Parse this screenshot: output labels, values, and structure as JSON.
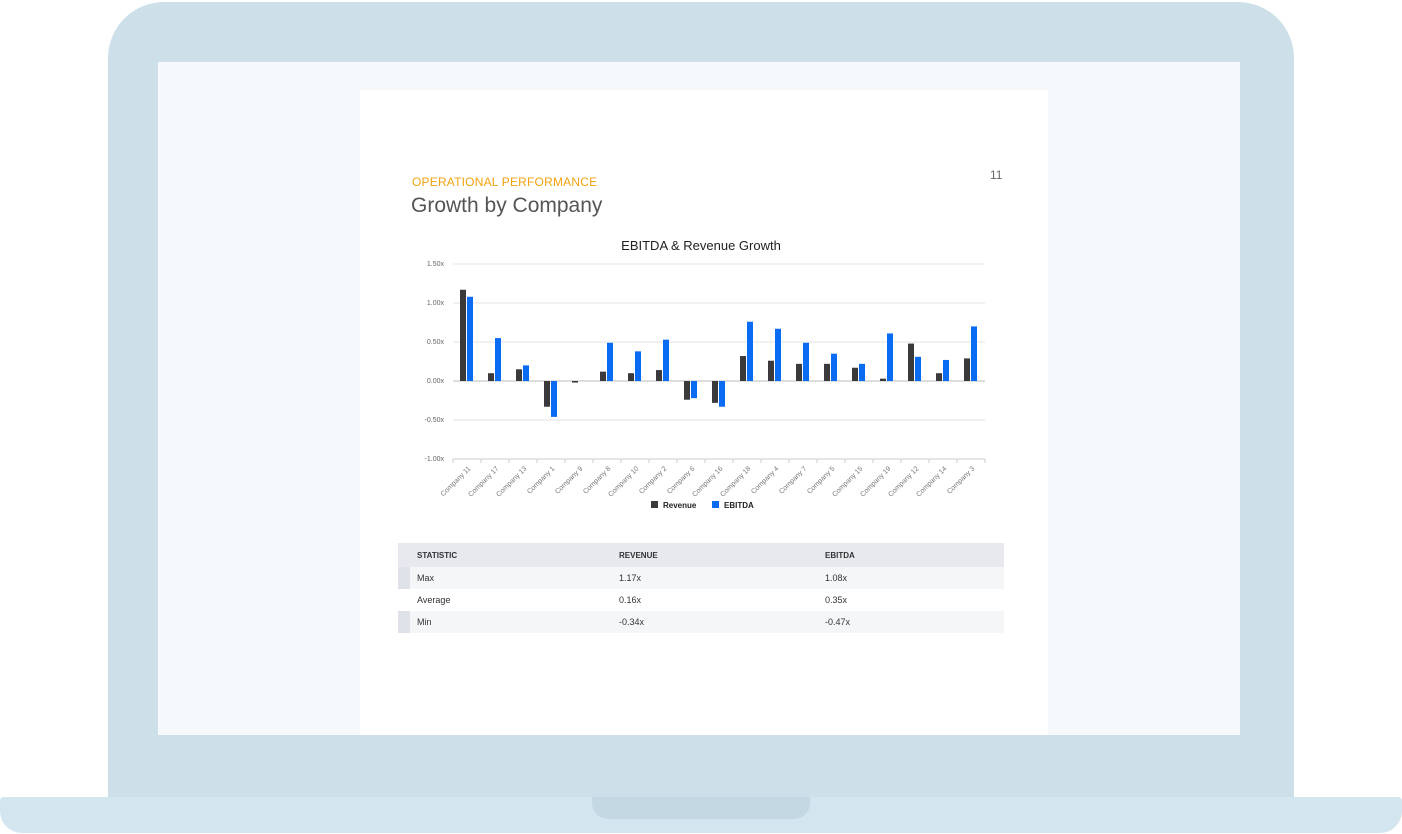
{
  "page": {
    "number": "11",
    "section": "OPERATIONAL PERFORMANCE",
    "title": "Growth by Company"
  },
  "colors": {
    "revenue": "#3a3a3c",
    "ebitda": "#0a6cf2",
    "section_label": "#f2a20d",
    "laptop": "#cde0ea"
  },
  "chart_data": {
    "type": "bar",
    "title": "EBITDA & Revenue Growth",
    "xlabel": "",
    "ylabel": "",
    "ylim": [
      -1.0,
      1.5
    ],
    "yticks": [
      "1.50x",
      "1.00x",
      "0.50x",
      "0.00x",
      "-0.50x",
      "-1.00x"
    ],
    "ytick_values": [
      1.5,
      1.0,
      0.5,
      0.0,
      -0.5,
      -1.0
    ],
    "grid": true,
    "legend_position": "bottom",
    "categories": [
      "Company 11",
      "Company 17",
      "Company 13",
      "Company 1",
      "Company 9",
      "Company 8",
      "Company 10",
      "Company 2",
      "Company 6",
      "Company 16",
      "Company 18",
      "Company 4",
      "Company 7",
      "Company 5",
      "Company 15",
      "Company 19",
      "Company 12",
      "Company 14",
      "Company 3"
    ],
    "series": [
      {
        "name": "Revenue",
        "values": [
          1.17,
          0.1,
          0.15,
          -0.33,
          -0.02,
          0.12,
          0.1,
          0.14,
          -0.24,
          -0.28,
          0.32,
          0.26,
          0.22,
          0.22,
          0.17,
          0.03,
          0.48,
          0.1,
          0.29
        ]
      },
      {
        "name": "EBITDA",
        "values": [
          1.08,
          0.55,
          0.2,
          -0.46,
          0.0,
          0.49,
          0.38,
          0.53,
          -0.22,
          -0.33,
          0.76,
          0.67,
          0.49,
          0.35,
          0.22,
          0.61,
          0.31,
          0.27,
          0.7
        ]
      }
    ]
  },
  "stats_table": {
    "headers": [
      "STATISTIC",
      "REVENUE",
      "EBITDA"
    ],
    "rows": [
      [
        "Max",
        "1.17x",
        "1.08x"
      ],
      [
        "Average",
        "0.16x",
        "0.35x"
      ],
      [
        "Min",
        "-0.34x",
        "-0.47x"
      ]
    ]
  }
}
